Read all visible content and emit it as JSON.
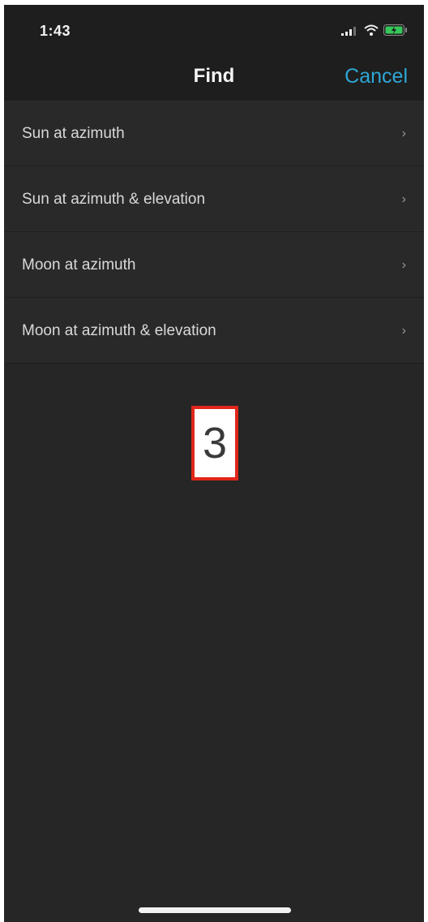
{
  "status_bar": {
    "time": "1:43",
    "icons": [
      "signal-icon",
      "wifi-icon",
      "battery-charging-icon"
    ],
    "battery_color": "#35c759"
  },
  "nav": {
    "title": "Find",
    "cancel_label": "Cancel",
    "accent_color": "#2ea6d6"
  },
  "list": {
    "items": [
      {
        "label": "Sun at azimuth"
      },
      {
        "label": "Sun at azimuth & elevation"
      },
      {
        "label": "Moon at azimuth"
      },
      {
        "label": "Moon at azimuth & elevation"
      }
    ],
    "chevron_glyph": "›"
  },
  "overlay": {
    "label": "3"
  }
}
